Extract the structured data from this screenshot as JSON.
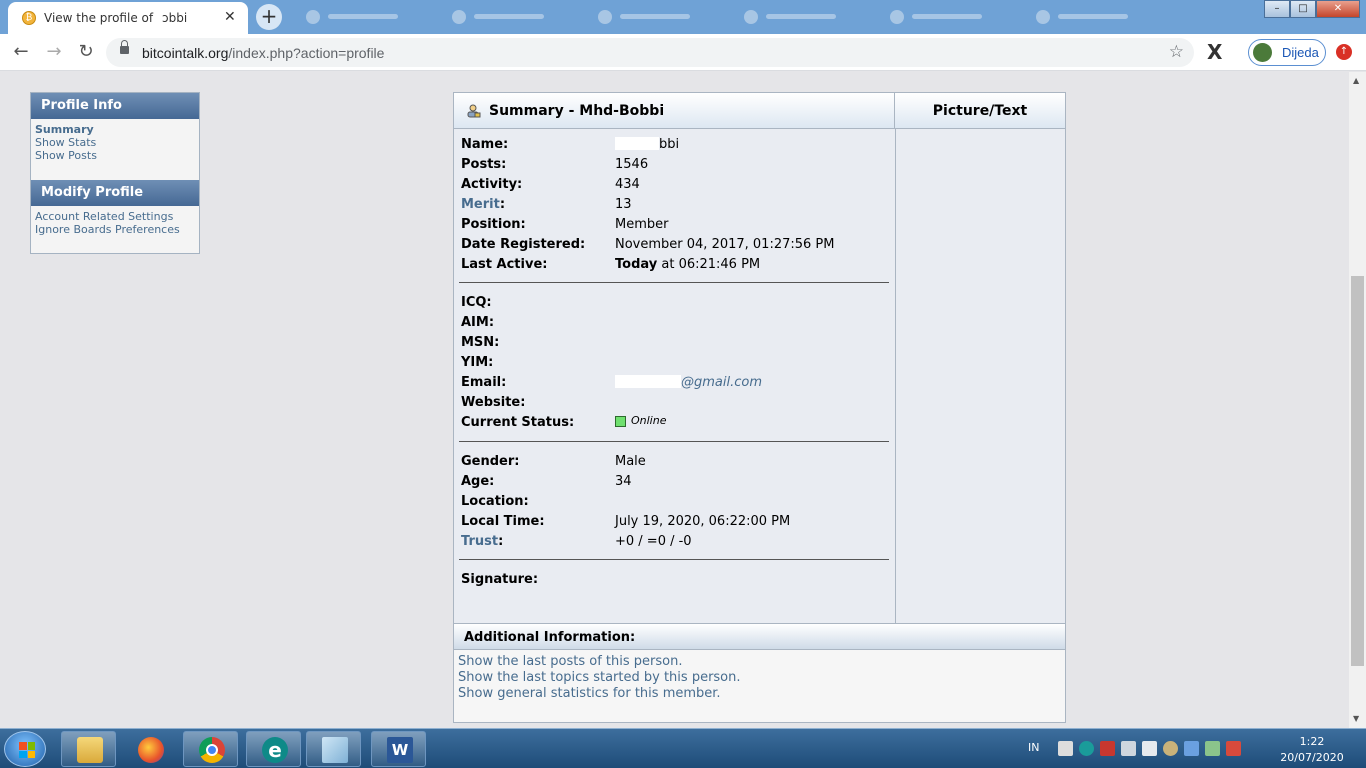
{
  "browser": {
    "active_tab_title": "View the profile of",
    "active_tab_suffix": "ɔbbi",
    "close_glyph": "✕",
    "new_tab_glyph": "+",
    "url_domain": "bitcointalk.org",
    "url_path": "/index.php?action=profile",
    "profile_name": "Dijeda",
    "window_minimize": "–",
    "window_restore": "□",
    "window_close": "✕"
  },
  "sidebar": {
    "profile_info_heading": "Profile Info",
    "profile_info_items": [
      "Summary",
      "Show Stats",
      "Show Posts"
    ],
    "modify_profile_heading": "Modify Profile",
    "modify_profile_items": [
      "Account Related Settings",
      "Ignore Boards Preferences"
    ]
  },
  "summary": {
    "title": "Summary - Mhd-Bobbi",
    "picture_heading": "Picture/Text",
    "name_label": "Name:",
    "name_value": "bbi",
    "posts_label": "Posts:",
    "posts_value": "1546",
    "activity_label": "Activity:",
    "activity_value": "434",
    "merit_label": "Merit",
    "merit_colon": ":",
    "merit_value": "13",
    "position_label": "Position:",
    "position_value": "Member",
    "registered_label": "Date Registered:",
    "registered_value": "November 04, 2017, 01:27:56 PM",
    "last_active_label": "Last Active:",
    "last_active_today": "Today",
    "last_active_rest": " at 06:21:46 PM",
    "icq_label": "ICQ:",
    "aim_label": "AIM:",
    "msn_label": "MSN:",
    "yim_label": "YIM:",
    "email_label": "Email:",
    "email_value": "@gmail.com",
    "website_label": "Website:",
    "status_label": "Current Status:",
    "status_value": "Online",
    "gender_label": "Gender:",
    "gender_value": "Male",
    "age_label": "Age:",
    "age_value": "34",
    "location_label": "Location:",
    "local_time_label": "Local Time:",
    "local_time_value": "July 19, 2020, 06:22:00 PM",
    "trust_label": "Trust",
    "trust_colon": ":",
    "trust_value": "+0 / =0 / -0",
    "signature_label": "Signature:"
  },
  "additional": {
    "heading": "Additional Information:",
    "links": [
      "Show the last posts of this person.",
      "Show the last topics started by this person.",
      "Show general statistics for this member."
    ]
  },
  "taskbar": {
    "language": "IN",
    "time": "1:22",
    "date": "20/07/2020"
  },
  "icons": [
    "bitcoin-favicon-icon",
    "back-arrow-icon",
    "forward-arrow-icon",
    "reload-icon",
    "lock-icon",
    "bookmark-star-icon",
    "extension-x-icon",
    "update-icon",
    "profile-summary-icon",
    "windows-start-icon"
  ]
}
